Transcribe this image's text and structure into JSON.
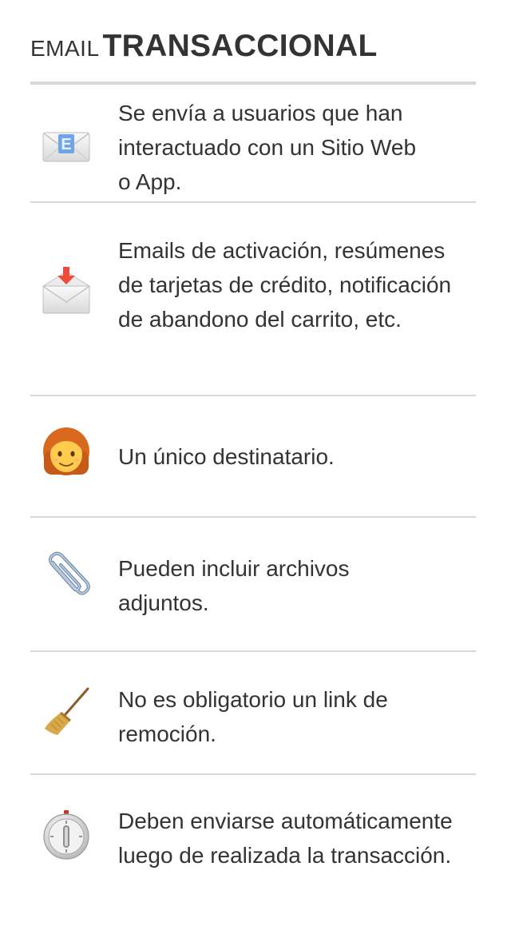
{
  "header": {
    "title_light": "EMAIL",
    "title_bold": "TRANSACCIONAL"
  },
  "items": [
    {
      "icon": "e-mail-envelope-icon",
      "text": "Se envía a usuarios que han\ninteractuado con un Sitio Web\no App."
    },
    {
      "icon": "incoming-envelope-icon",
      "text": "Emails de activación, resúmenes\nde tarjetas de crédito, notificación\nde abandono del carrito, etc."
    },
    {
      "icon": "woman-face-icon",
      "text": "Un único destinatario."
    },
    {
      "icon": "paperclip-icon",
      "text": "Pueden incluir archivos\nadjuntos."
    },
    {
      "icon": "broom-icon",
      "text": "No es obligatorio un link de\nremoción."
    },
    {
      "icon": "timer-clock-icon",
      "text": "Deben enviarse automáticamente\nluego de realizada la transacción."
    }
  ]
}
